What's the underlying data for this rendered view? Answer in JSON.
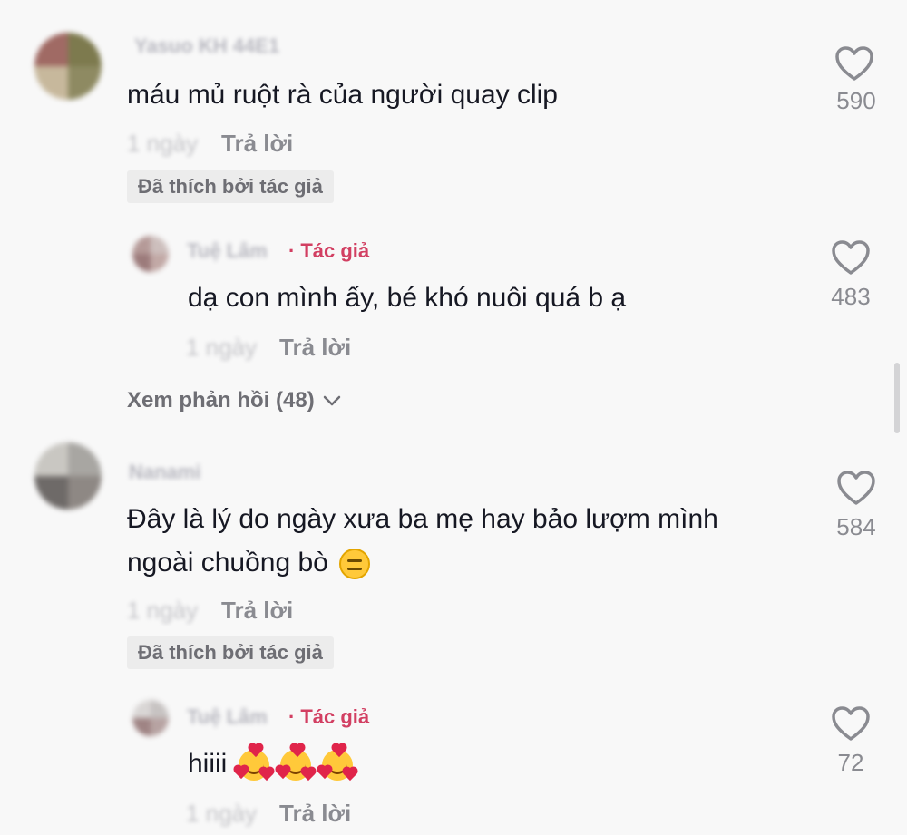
{
  "comments": [
    {
      "username": "Yasuo KH 44E1",
      "text": "máu mủ ruột rà của người quay clip",
      "time": "1 ngày",
      "reply_label": "Trả lời",
      "liked_badge": "Đã thích bởi tác giả",
      "likes": "590"
    },
    {
      "username": "Tuệ Lâm",
      "author_tag": "Tác giả",
      "text": "dạ con mình ấy, bé khó nuôi quá b ạ",
      "time": "1 ngày",
      "reply_label": "Trả lời",
      "likes": "483"
    },
    {
      "view_replies": "Xem phản hồi (48)"
    },
    {
      "username": "Nanami",
      "text_line1": "Đây là lý do ngày xưa ba mẹ hay bảo lượm mình",
      "text_line2": "ngoài chuồng bò",
      "time": "1 ngày",
      "reply_label": "Trả lời",
      "liked_badge": "Đã thích bởi tác giả",
      "likes": "584"
    },
    {
      "username": "Tuệ Lâm",
      "author_tag": "Tác giả",
      "text": "hiiii",
      "time": "1 ngày",
      "reply_label": "Trả lời",
      "likes": "72"
    }
  ],
  "icons": {
    "heart": "heart-icon",
    "chevron": "chevron-down-icon",
    "neutral_emoji": "expressionless-face-emoji",
    "love_emoji": "smiling-face-with-hearts-emoji"
  },
  "colors": {
    "author_tag": "#d23f62",
    "background": "#f8f8f8"
  }
}
